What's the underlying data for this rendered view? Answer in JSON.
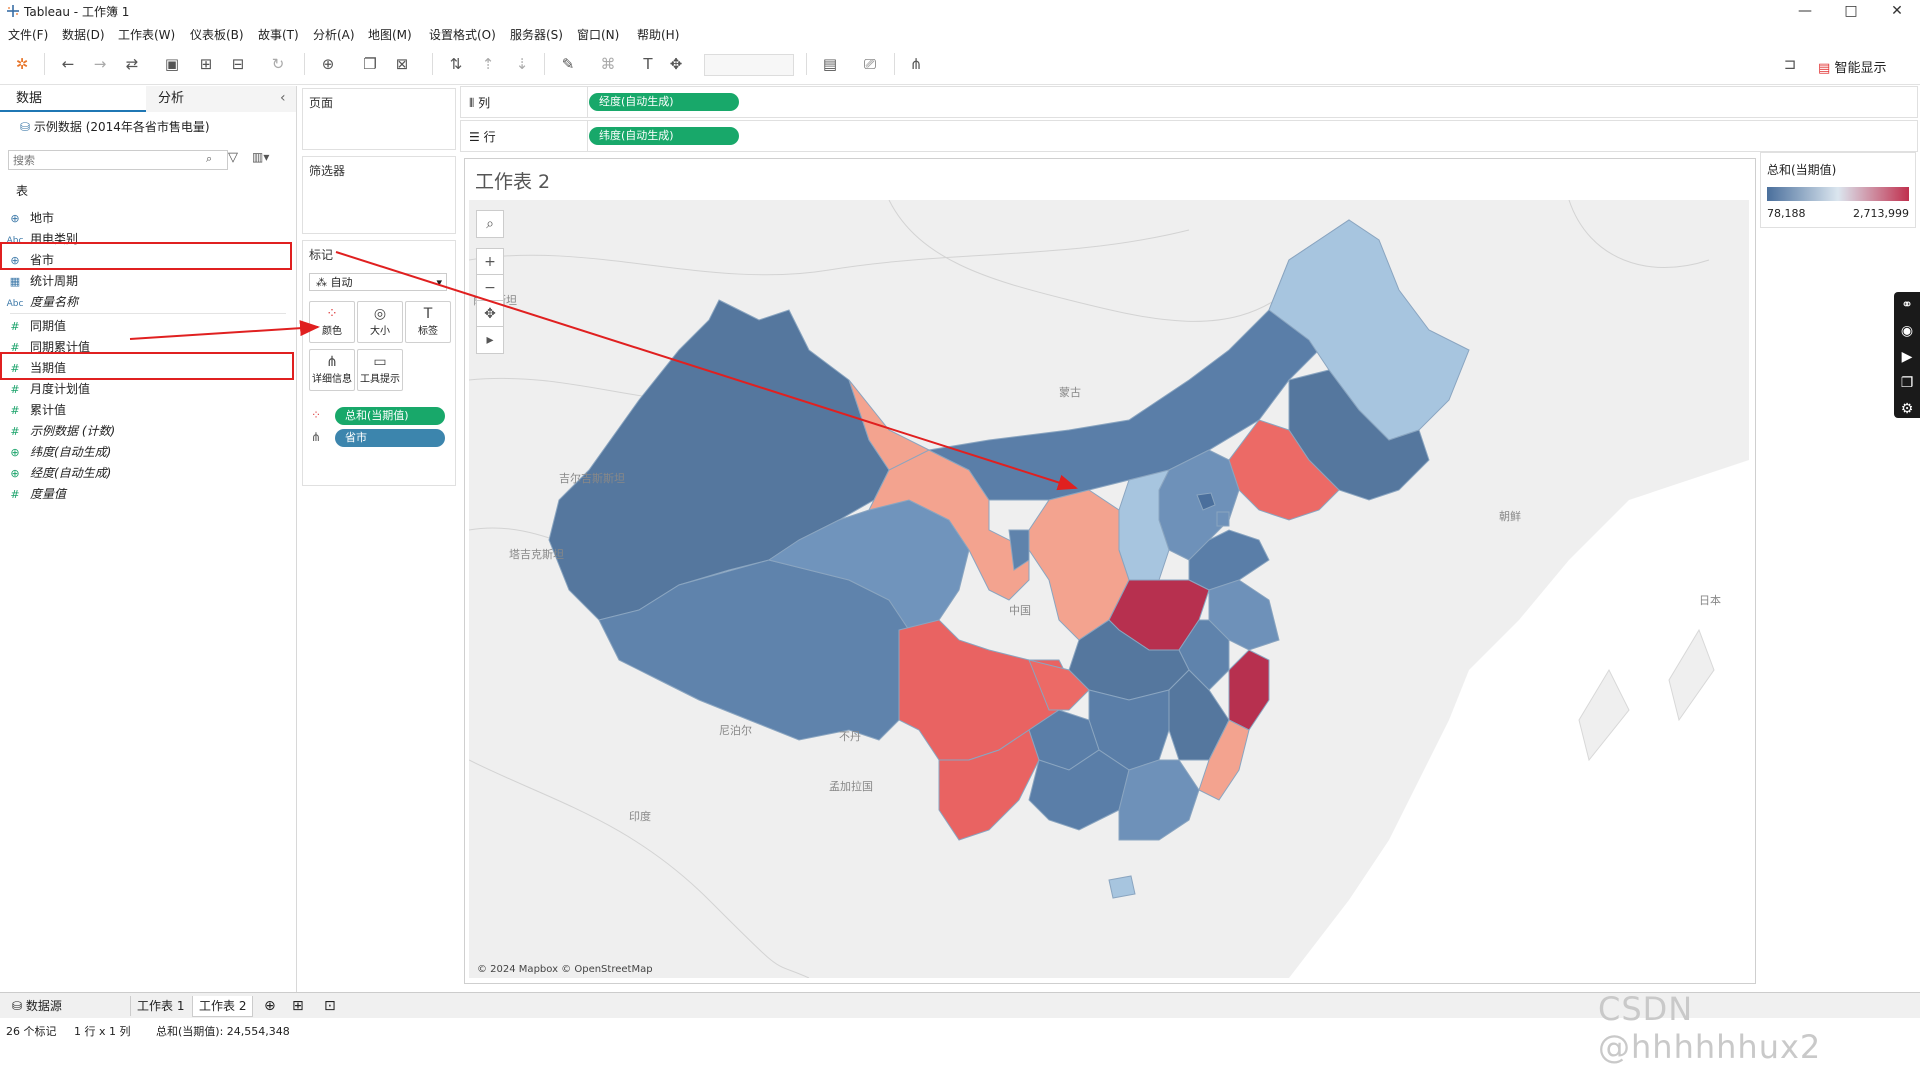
{
  "window": {
    "title": "Tableau - 工作簿 1",
    "min": "—",
    "max": "□",
    "close": "✕"
  },
  "menu": [
    "文件(F)",
    "数据(D)",
    "工作表(W)",
    "仪表板(B)",
    "故事(T)",
    "分析(A)",
    "地图(M)",
    "设置格式(O)",
    "服务器(S)",
    "窗口(N)",
    "帮助(H)"
  ],
  "toolbar": {
    "show_me_label": "智能显示"
  },
  "left_pane": {
    "tab_data": "数据",
    "tab_analysis": "分析",
    "collapse_icon": "‹",
    "datasource": "示例数据 (2014年各省市售电量)",
    "search_placeholder": "搜索",
    "tables_header": "表",
    "fields": [
      {
        "icon": "globe",
        "name": "地市",
        "italic": false,
        "color": "#3c78a8"
      },
      {
        "icon": "Abc",
        "name": "用电类别",
        "italic": false,
        "color": "#3c78a8"
      },
      {
        "icon": "globe",
        "name": "省市",
        "italic": false,
        "color": "#3c78a8"
      },
      {
        "icon": "calendar",
        "name": "统计周期",
        "italic": false,
        "color": "#3c78a8"
      },
      {
        "icon": "Abc",
        "name": "度量名称",
        "italic": true,
        "color": "#3c78a8"
      },
      {
        "icon": "#",
        "name": "同期值",
        "italic": false,
        "color": "#1aa36a"
      },
      {
        "icon": "#",
        "name": "同期累计值",
        "italic": false,
        "color": "#1aa36a"
      },
      {
        "icon": "#",
        "name": "当期值",
        "italic": false,
        "color": "#1aa36a"
      },
      {
        "icon": "#",
        "name": "月度计划值",
        "italic": false,
        "color": "#1aa36a"
      },
      {
        "icon": "#",
        "name": "累计值",
        "italic": false,
        "color": "#1aa36a"
      },
      {
        "icon": "#",
        "name": "示例数据 (计数)",
        "italic": true,
        "color": "#1aa36a"
      },
      {
        "icon": "globe",
        "name": "纬度(自动生成)",
        "italic": true,
        "color": "#1aa36a"
      },
      {
        "icon": "globe",
        "name": "经度(自动生成)",
        "italic": true,
        "color": "#1aa36a"
      },
      {
        "icon": "#",
        "name": "度量值",
        "italic": true,
        "color": "#1aa36a"
      }
    ]
  },
  "cards": {
    "pages": "页面",
    "filters": "筛选器",
    "marks": "标记",
    "mark_type": "自动",
    "buttons": [
      "颜色",
      "大小",
      "标签",
      "详细信息",
      "工具提示"
    ],
    "pill_color": "总和(当期值)",
    "pill_detail": "省市"
  },
  "shelves": {
    "columns_label": "列",
    "rows_label": "行",
    "columns_pill": "经度(自动生成)",
    "rows_pill": "纬度(自动生成)"
  },
  "sheet": {
    "title": "工作表 2",
    "attribution": "© 2024 Mapbox © OpenStreetMap",
    "map_labels": [
      "萨克斯坦",
      "蒙古",
      "吉尔吉斯斯坦",
      "塔吉克斯坦",
      "中国",
      "尼泊尔",
      "不丹",
      "孟加拉国",
      "印度",
      "朝鲜",
      "日本"
    ]
  },
  "legend": {
    "title": "总和(当期值)",
    "min_label": "78,188",
    "max_label": "2,713,999",
    "color_low": "#4a6f9c",
    "color_mid": "#dbe6ef",
    "color_high": "#c0304e"
  },
  "bottom": {
    "datasource_tab": "数据源",
    "sheets": [
      "工作表 1",
      "工作表 2"
    ]
  },
  "status": {
    "marks_count": "26 个标记",
    "rows_cols": "1 行 x 1 列",
    "sum": "总和(当期值): 24,554,348"
  },
  "watermark": "CSDN @hhhhhhux2"
}
